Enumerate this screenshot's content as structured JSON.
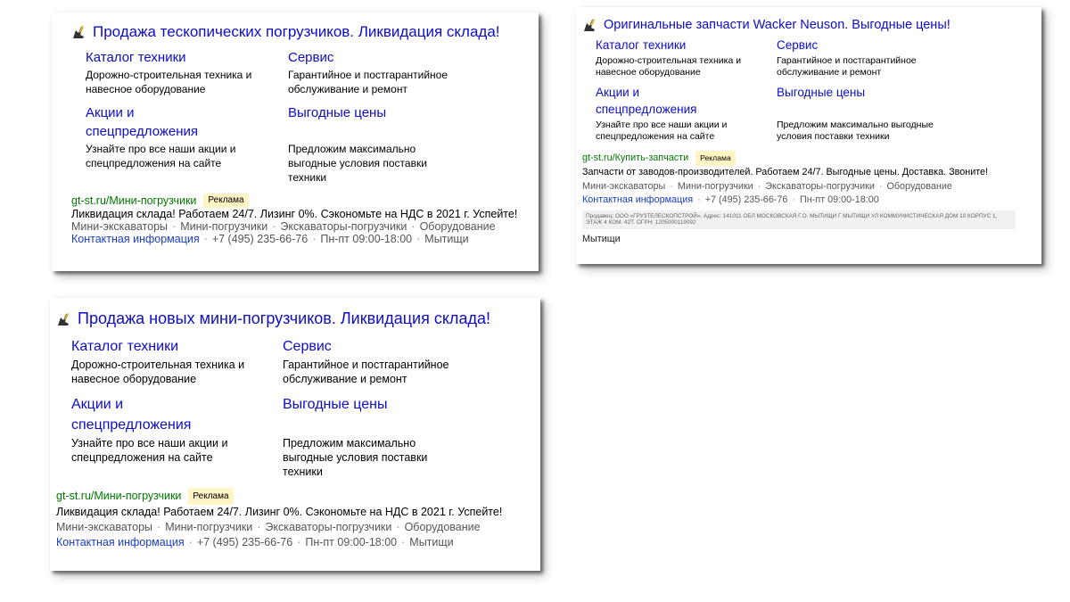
{
  "colors": {
    "title": "#0d0dc9",
    "display_url": "#007700",
    "ad_badge_bg": "#fff4c4",
    "contact_link": "#1a3dc9",
    "separator": "#888888"
  },
  "ads": [
    {
      "id": "ad-a",
      "title": "Продажа тескопических погрузчиков. Ликвидация склада!",
      "sitelinks": [
        {
          "label": "Каталог техники",
          "description": "Дорожно-строительная техника и навесное оборудование"
        },
        {
          "label": "Сервис",
          "description": "Гарантийное и постгарантийное обслуживание и ремонт"
        },
        {
          "label": "Акции и спецпредложения",
          "description": "Узнайте про все наши акции и спецпредложения на сайте"
        },
        {
          "label": "Выгодные цены",
          "description": "Предложим максимально выгодные условия поставки техники"
        }
      ],
      "display_url": "gt-st.ru/Мини-погрузчики",
      "ad_badge": "Реклама",
      "text": "Ликвидация склада! Работаем 24/7. Лизинг 0%. Сэкономьте на НДС в 2021 г. Успейте!",
      "quicklinks": [
        "Мини-экскаваторы",
        "Мини-погрузчики",
        "Экскаваторы-погрузчики",
        "Оборудование"
      ],
      "contact_label": "Контактная информация",
      "phone": "+7 (495) 235-66-76",
      "hours": "Пн-пт 09:00-18:00",
      "city": "Мытищи"
    },
    {
      "id": "ad-b",
      "title": "Оригинальные запчасти Wacker Neuson. Выгодные цены!",
      "sitelinks": [
        {
          "label": "Каталог техники",
          "description": "Дорожно-строительная техника и навесное оборудование"
        },
        {
          "label": "Сервис",
          "description": "Гарантийное и постгарантийное обслуживание и ремонт"
        },
        {
          "label": "Акции и спецпредложения",
          "description": "Узнайте про все наши акции и спецпредложения на сайте"
        },
        {
          "label": "Выгодные цены",
          "description": "Предложим максимально выгодные условия поставки техники"
        }
      ],
      "display_url": "gt-st.ru/Купить-запчасти",
      "ad_badge": "Реклама",
      "text": "Запчасти от заводов-производителей. Работаем 24/7. Выгодные цены. Доставка. Звоните!",
      "quicklinks": [
        "Мини-экскаваторы",
        "Мини-погрузчики",
        "Экскаваторы-погрузчики",
        "Оборудование"
      ],
      "contact_label": "Контактная информация",
      "phone": "+7 (495) 235-66-76",
      "hours": "Пн-пт 09:00-18:00",
      "legal": "Продавец: ООО «ГРУЗТЕЛЕСКОПСТРОЙ». Адрес: 141011 ОБЛ МОСКОВСКАЯ Г.О. МЫТИЩИ Г МЫТИЩИ УЛ КОММУНИСТИЧЕСКАЯ ДОМ 10 КОРПУС 1, ЭТАЖ 4 КОМ. 42Т. ОГРН: 1205000119092",
      "city_line": "Мытищи"
    },
    {
      "id": "ad-c",
      "title": "Продажа новых мини-погрузчиков. Ликвидация склада!",
      "sitelinks": [
        {
          "label": "Каталог техники",
          "description": "Дорожно-строительная техника и навесное оборудование"
        },
        {
          "label": "Сервис",
          "description": "Гарантийное и постгарантийное обслуживание и ремонт"
        },
        {
          "label": "Акции и спецпредложения",
          "description": "Узнайте про все наши акции и спецпредложения на сайте"
        },
        {
          "label": "Выгодные цены",
          "description": "Предложим максимально выгодные условия поставки техники"
        }
      ],
      "display_url": "gt-st.ru/Мини-погрузчики",
      "ad_badge": "Реклама",
      "text": "Ликвидация склада! Работаем 24/7. Лизинг 0%. Сэкономьте на НДС в 2021 г. Успейте!",
      "quicklinks": [
        "Мини-экскаваторы",
        "Мини-погрузчики",
        "Экскаваторы-погрузчики",
        "Оборудование"
      ],
      "contact_label": "Контактная информация",
      "phone": "+7 (495) 235-66-76",
      "hours": "Пн-пт 09:00-18:00",
      "city": "Мытищи"
    }
  ]
}
